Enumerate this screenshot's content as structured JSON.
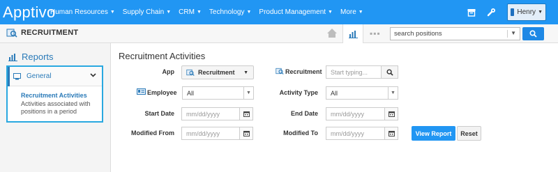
{
  "brand": {
    "logo": "Apptivo"
  },
  "topnav": [
    {
      "label": "Human Resources"
    },
    {
      "label": "Supply Chain"
    },
    {
      "label": "CRM"
    },
    {
      "label": "Technology"
    },
    {
      "label": "Product Management"
    },
    {
      "label": "More"
    }
  ],
  "user": {
    "name": "Henry"
  },
  "module": {
    "title": "RECRUITMENT"
  },
  "search": {
    "placeholder": "search positions"
  },
  "sidebar": {
    "title": "Reports",
    "section": "General",
    "link_title": "Recruitment Activities",
    "link_desc": "Activities associated with positions in a period"
  },
  "form": {
    "title": "Recruitment Activities",
    "app_label": "App",
    "app_value": "Recruitment",
    "recruitment_label": "Recruitment",
    "recruitment_placeholder": "Start typing...",
    "employee_label": "Employee",
    "employee_value": "All",
    "activity_type_label": "Activity Type",
    "activity_type_value": "All",
    "start_date_label": "Start Date",
    "start_date_placeholder": "mm/dd/yyyy",
    "end_date_label": "End Date",
    "end_date_placeholder": "mm/dd/yyyy",
    "modified_from_label": "Modified From",
    "modified_from_placeholder": "mm/dd/yyyy",
    "modified_to_label": "Modified To",
    "modified_to_placeholder": "mm/dd/yyyy",
    "view_report_label": "View Report",
    "reset_label": "Reset"
  },
  "colors": {
    "topbar": "#2196f3",
    "accent": "#2a7ab8",
    "highlight_border": "#29a8e0"
  }
}
